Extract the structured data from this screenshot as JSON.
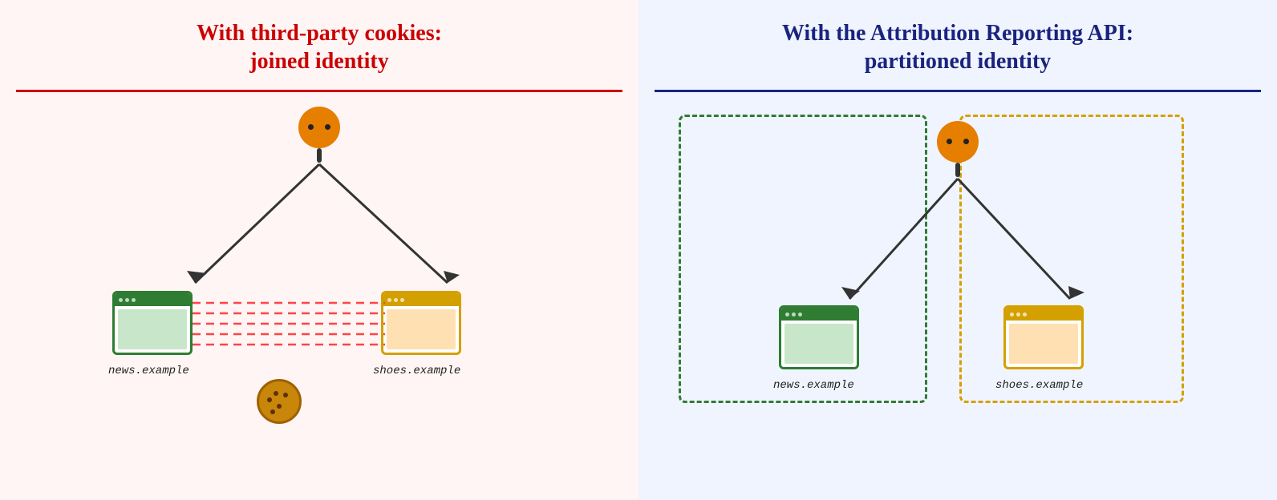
{
  "left_panel": {
    "title_line1": "With third-party cookies:",
    "title_line2": "joined identity",
    "bg": "#fff5f5",
    "title_color": "#cc0000",
    "divider_color": "#cc0000",
    "left_label": "news.example",
    "right_label": "shoes.example"
  },
  "right_panel": {
    "title_line1": "With the Attribution Reporting API:",
    "title_line2": "partitioned identity",
    "bg": "#f0f4ff",
    "title_color": "#1a237e",
    "divider_color": "#1a237e",
    "left_label": "news.example",
    "right_label": "shoes.example"
  }
}
